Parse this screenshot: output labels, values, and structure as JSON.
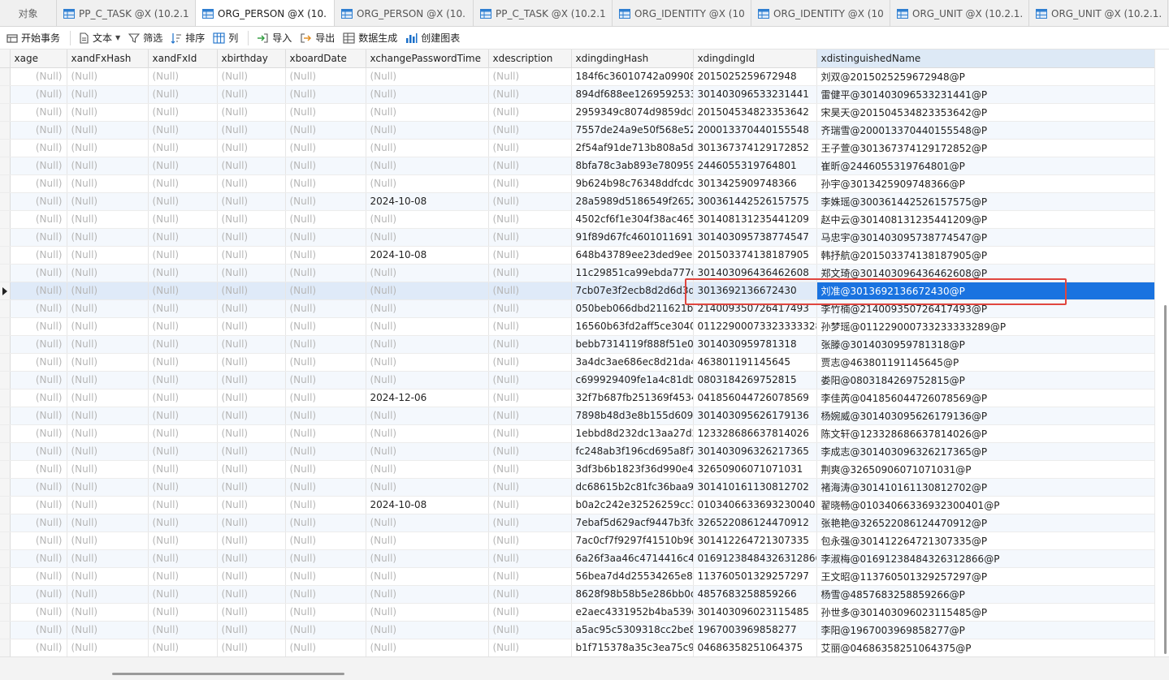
{
  "tabs": [
    {
      "label": "对象",
      "kind": "objects"
    },
    {
      "label": "PP_C_TASK @X (10.2.1...",
      "kind": "table"
    },
    {
      "label": "ORG_PERSON @X (10....",
      "kind": "table",
      "active": true
    },
    {
      "label": "ORG_PERSON @X (10....",
      "kind": "table"
    },
    {
      "label": "PP_C_TASK @X (10.2.1...",
      "kind": "table"
    },
    {
      "label": "ORG_IDENTITY @X (10...",
      "kind": "table"
    },
    {
      "label": "ORG_IDENTITY @X (10...",
      "kind": "table"
    },
    {
      "label": "ORG_UNIT @X (10.2.1...",
      "kind": "table"
    },
    {
      "label": "ORG_UNIT @X (10.2.1...",
      "kind": "table"
    }
  ],
  "toolbar": {
    "begin_transaction": "开始事务",
    "text": "文本",
    "filter": "筛选",
    "sort": "排序",
    "columns": "列",
    "import": "导入",
    "export": "导出",
    "generate_data": "数据生成",
    "create_chart": "创建图表"
  },
  "columns": [
    "xage",
    "xandFxHash",
    "xandFxId",
    "xbirthday",
    "xboardDate",
    "xchangePasswordTime",
    "xdescription",
    "xdingdingHash",
    "xdingdingId",
    "xdistinguishedName"
  ],
  "null_text": "(Null)",
  "current_row_index": 12,
  "selected_column": "xdistinguishedName",
  "colors": {
    "selection": "#1a73e0",
    "highlight_box": "#e0463f",
    "null_text": "#b6b6b6",
    "row_alt": "#f4f8fd"
  },
  "rows": [
    {
      "pwd": "",
      "hash": "184f6c36010742a099087",
      "did": "2015025259672948",
      "dn": "刘双@2015025259672948@P"
    },
    {
      "pwd": "",
      "hash": "894df688ee1269592533",
      "did": "301403096533231441",
      "dn": "雷健平@301403096533231441@P"
    },
    {
      "pwd": "",
      "hash": "2959349c8074d9859dcb",
      "did": "201504534823353642",
      "dn": "宋昊天@201504534823353642@P"
    },
    {
      "pwd": "",
      "hash": "7557de24a9e50f568e52",
      "did": "200013370440155548",
      "dn": "齐瑞雪@200013370440155548@P"
    },
    {
      "pwd": "",
      "hash": "2f54af91de713b808a5da",
      "did": "301367374129172852",
      "dn": "王子萱@301367374129172852@P"
    },
    {
      "pwd": "",
      "hash": "8bfa78c3ab893e780959",
      "did": "2446055319764801",
      "dn": "崔昕@2446055319764801@P"
    },
    {
      "pwd": "",
      "hash": "9b624b98c76348ddfcdd",
      "did": "3013425909748366",
      "dn": "孙宇@3013425909748366@P"
    },
    {
      "pwd": "2024-10-08",
      "hash": "28a5989d5186549f2652",
      "did": "300361442526157575",
      "dn": "李姝瑶@300361442526157575@P"
    },
    {
      "pwd": "",
      "hash": "4502cf6f1e304f38ac4654",
      "did": "301408131235441209",
      "dn": "赵中云@301408131235441209@P"
    },
    {
      "pwd": "",
      "hash": "91f89d67fc46010116910",
      "did": "301403095738774547",
      "dn": "马忠宇@301403095738774547@P"
    },
    {
      "pwd": "2024-10-08",
      "hash": "648b43789ee23ded9eea",
      "did": "201503374138187905",
      "dn": "韩抒航@201503374138187905@P"
    },
    {
      "pwd": "",
      "hash": "11c29851ca99ebda777d",
      "did": "301403096436462608",
      "dn": "郑文琦@301403096436462608@P"
    },
    {
      "pwd": "",
      "hash": "7cb07e3f2ecb8d2d6d3d",
      "did": "3013692136672430",
      "dn": "刘准@3013692136672430@P"
    },
    {
      "pwd": "",
      "hash": "050beb066dbd211621b",
      "did": "214009350726417493",
      "dn": "李竹楠@214009350726417493@P"
    },
    {
      "pwd": "",
      "hash": "16560b63fd2aff5ce3040",
      "did": "011229000733233333289",
      "dn": "孙梦瑶@011229000733233333289@P"
    },
    {
      "pwd": "",
      "hash": "bebb7314119f888f51e08",
      "did": "3014030959781318",
      "dn": "张滕@3014030959781318@P"
    },
    {
      "pwd": "",
      "hash": "3a4dc3ae686ec8d21da4",
      "did": "463801191145645",
      "dn": "贾志@463801191145645@P"
    },
    {
      "pwd": "",
      "hash": "c699929409fe1a4c81dbc",
      "did": "0803184269752815",
      "dn": "娄阳@0803184269752815@P"
    },
    {
      "pwd": "2024-12-06",
      "hash": "32f7b687fb251369f4534",
      "did": "041856044726078569",
      "dn": "李佳芮@041856044726078569@P"
    },
    {
      "pwd": "",
      "hash": "7898b48d3e8b155d609f",
      "did": "301403095626179136",
      "dn": "杨婉威@301403095626179136@P"
    },
    {
      "pwd": "",
      "hash": "1ebbd8d232dc13aa27d2",
      "did": "123328686637814026",
      "dn": "陈文轩@123328686637814026@P"
    },
    {
      "pwd": "",
      "hash": "fc248ab3f196cd695a8f7",
      "did": "301403096326217365",
      "dn": "李成志@301403096326217365@P"
    },
    {
      "pwd": "",
      "hash": "3df3b6b1823f36d990e4",
      "did": "32650906071071031",
      "dn": "荆爽@32650906071071031@P"
    },
    {
      "pwd": "",
      "hash": "dc68615b2c81fc36baa94",
      "did": "301410161130812702",
      "dn": "褚海涛@301410161130812702@P"
    },
    {
      "pwd": "2024-10-08",
      "hash": "b0a2c242e32526259cc3",
      "did": "01034066336932300401",
      "dn": "翟晓畅@01034066336932300401@P"
    },
    {
      "pwd": "",
      "hash": "7ebaf5d629acf9447b3fc",
      "did": "326522086124470912",
      "dn": "张艳艳@326522086124470912@P"
    },
    {
      "pwd": "",
      "hash": "7ac0cf7f9297f41510b96",
      "did": "301412264721307335",
      "dn": "包永强@301412264721307335@P"
    },
    {
      "pwd": "",
      "hash": "6a26f3aa46c4714416c43",
      "did": "01691238484326312866",
      "dn": "李淑梅@01691238484326312866@P"
    },
    {
      "pwd": "",
      "hash": "56bea7d4d25534265e85",
      "did": "113760501329257297",
      "dn": "王文昭@113760501329257297@P"
    },
    {
      "pwd": "",
      "hash": "8628f98b58b5e286bb0d",
      "did": "4857683258859266",
      "dn": "杨雪@4857683258859266@P"
    },
    {
      "pwd": "",
      "hash": "e2aec4331952b4ba539e",
      "did": "301403096023115485",
      "dn": "孙世多@301403096023115485@P"
    },
    {
      "pwd": "",
      "hash": "a5ac95c5309318cc2be8",
      "did": "1967003969858277",
      "dn": "李阳@1967003969858277@P"
    },
    {
      "pwd": "",
      "hash": "b1f715378a35c3ea75c92",
      "did": "04686358251064375",
      "dn": "艾丽@04686358251064375@P"
    }
  ]
}
